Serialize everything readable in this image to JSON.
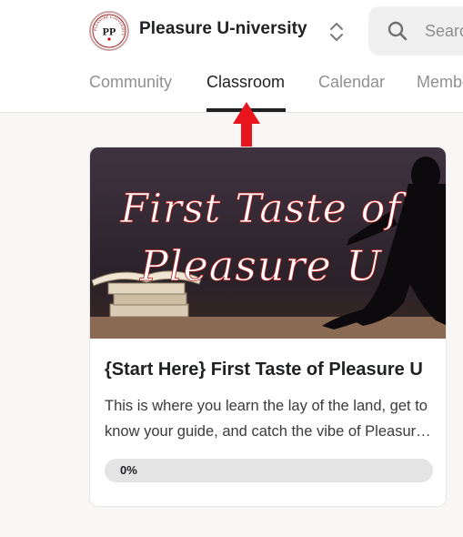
{
  "header": {
    "group_name": "Pleasure U-niversity",
    "logo_monogram": "PP",
    "logo_ring_text": "PLEASURE U-NIVERSITY",
    "search_placeholder": "Search"
  },
  "tabs": [
    {
      "label": "Community",
      "active": false
    },
    {
      "label": "Classroom",
      "active": true
    },
    {
      "label": "Calendar",
      "active": false
    },
    {
      "label": "Members",
      "active": false
    }
  ],
  "course": {
    "cover_lines": [
      "First Taste of",
      "Pleasure U"
    ],
    "title": "{Start Here} First Taste of Pleasure U",
    "description": "This is where you learn the lay of the land, get to know your guide, and catch the vibe of Pleasure U.",
    "progress_label": "0%",
    "progress_fraction": 0
  },
  "colors": {
    "annotation_arrow": "#e8141e",
    "text_primary": "#202124",
    "text_muted": "#909090",
    "page_background": "#f8f7f5"
  }
}
